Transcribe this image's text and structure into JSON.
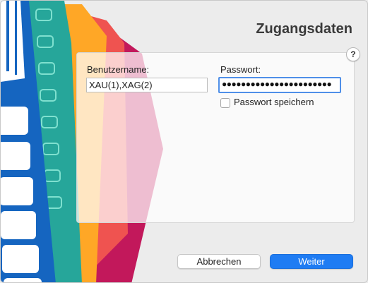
{
  "dialog": {
    "title": "Zugangsdaten",
    "help_symbol": "?"
  },
  "form": {
    "username_label": "Benutzername:",
    "username_value": "XAU(1),XAG(2)",
    "password_label": "Passwort:",
    "password_masked": "●●●●●●●●●●●●●●●●●●●●●●●",
    "save_password_label": "Passwort speichern",
    "save_password_checked": false
  },
  "buttons": {
    "cancel": "Abbrechen",
    "next": "Weiter"
  },
  "icons": {
    "decor": "stacked-cards-illustration",
    "help": "help-icon"
  },
  "colors": {
    "accent": "#1f7cf3",
    "focus_ring": "#4f8fe8"
  }
}
